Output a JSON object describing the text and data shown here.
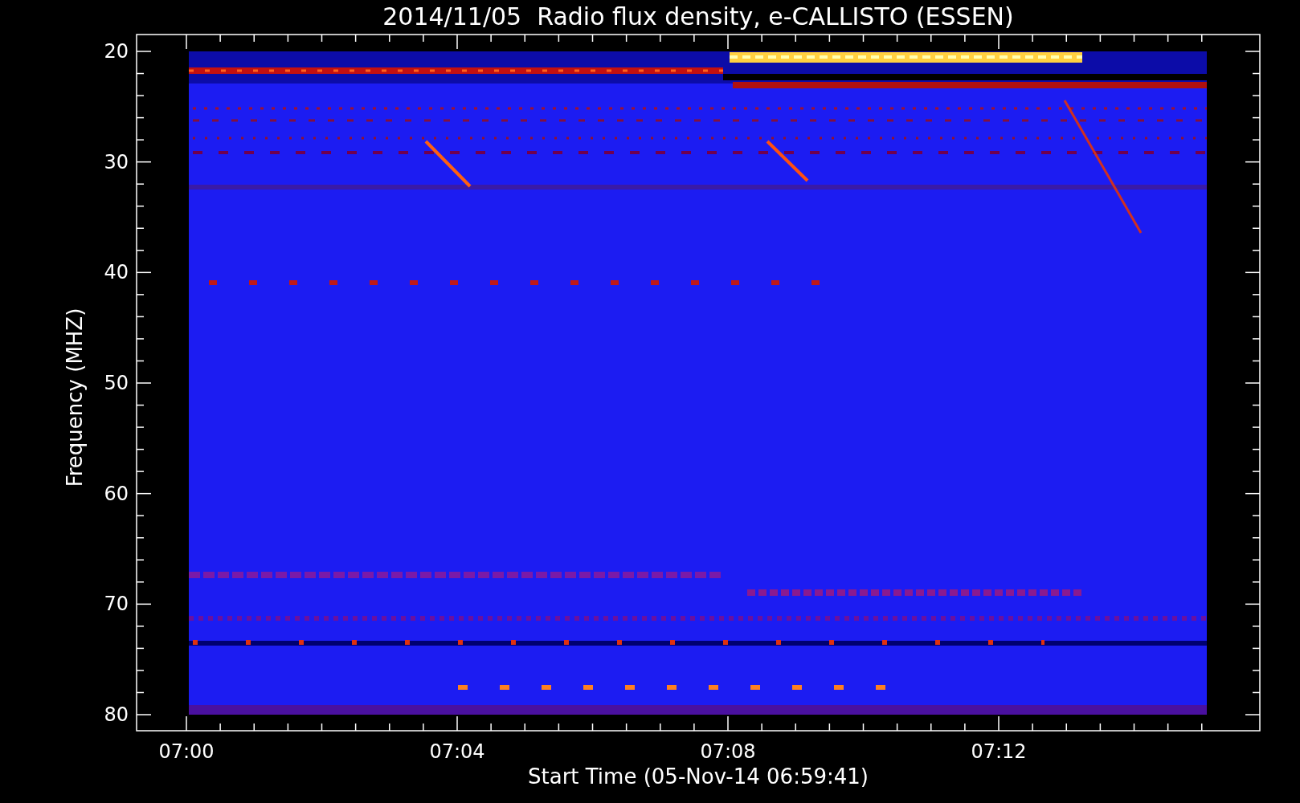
{
  "title": "2014/11/05  Radio flux density, e-CALLISTO (ESSEN)",
  "y_axis": {
    "label": "Frequency (MHZ)",
    "ticks": [
      "20",
      "30",
      "40",
      "50",
      "60",
      "70",
      "80"
    ]
  },
  "x_axis": {
    "label": "Start Time (05-Nov-14 06:59:41)",
    "ticks": [
      "07:00",
      "07:04",
      "07:08",
      "07:12"
    ]
  }
}
